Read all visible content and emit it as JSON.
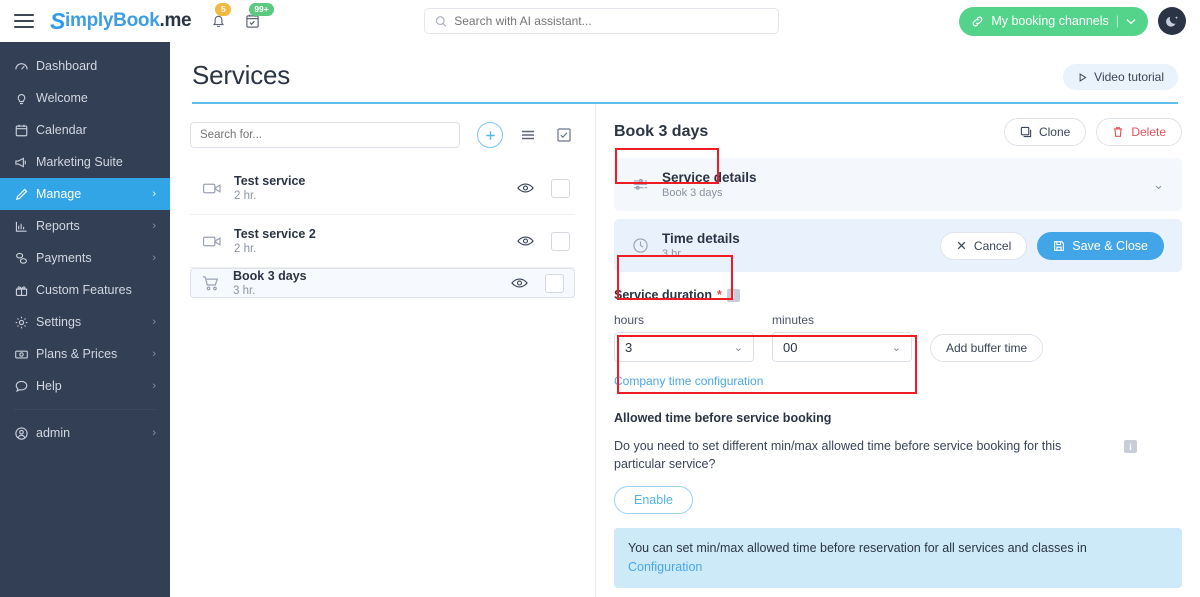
{
  "topbar": {
    "menu_icon": "hamburger-icon",
    "logo": {
      "s": "S",
      "simply": "implyBook",
      "dotme": ".me"
    },
    "bell_badge": "5",
    "calendar_badge": "99+",
    "search": {
      "placeholder": "Search with AI assistant...",
      "value": ""
    },
    "booking_channels_label": "My booking channels",
    "theme_toggle": "moon-icon"
  },
  "sidebar": {
    "items": [
      {
        "label": "Dashboard",
        "icon": "dashboard-icon",
        "chevron": false,
        "active": false
      },
      {
        "label": "Welcome",
        "icon": "bulb-icon",
        "chevron": false,
        "active": false
      },
      {
        "label": "Calendar",
        "icon": "calendar-icon",
        "chevron": false,
        "active": false
      },
      {
        "label": "Marketing Suite",
        "icon": "megaphone-icon",
        "chevron": false,
        "active": false
      },
      {
        "label": "Manage",
        "icon": "pencil-icon",
        "chevron": true,
        "active": true
      },
      {
        "label": "Reports",
        "icon": "chart-icon",
        "chevron": true,
        "active": false
      },
      {
        "label": "Payments",
        "icon": "coins-icon",
        "chevron": true,
        "active": false
      },
      {
        "label": "Custom Features",
        "icon": "gift-icon",
        "chevron": false,
        "active": false
      },
      {
        "label": "Settings",
        "icon": "gear-icon",
        "chevron": true,
        "active": false
      },
      {
        "label": "Plans & Prices",
        "icon": "money-icon",
        "chevron": true,
        "active": false
      },
      {
        "label": "Help",
        "icon": "chat-icon",
        "chevron": true,
        "active": false
      }
    ],
    "user": {
      "label": "admin",
      "icon": "user-icon",
      "chevron": true
    }
  },
  "page": {
    "title": "Services",
    "video_tutorial_label": "Video tutorial"
  },
  "list": {
    "search_placeholder": "Search for...",
    "search_value": "",
    "add_label": "+",
    "rows": [
      {
        "name": "Test service",
        "duration": "2 hr.",
        "icon": "video-camera-icon",
        "selected": false
      },
      {
        "name": "Test service 2",
        "duration": "2 hr.",
        "icon": "video-camera-icon",
        "selected": false
      },
      {
        "name": "Book 3 days",
        "duration": "3 hr.",
        "icon": "shopping-cart-icon",
        "selected": true
      }
    ]
  },
  "detail": {
    "title": "Book 3 days",
    "clone_label": "Clone",
    "delete_label": "Delete",
    "sections": {
      "service_details": {
        "title": "Service details",
        "subtitle": "Book 3 days"
      },
      "time_details": {
        "title": "Time details",
        "subtitle": "3 hr.",
        "cancel_label": "Cancel",
        "save_label": "Save & Close"
      }
    },
    "form": {
      "duration_label": "Service duration",
      "required_mark": "*",
      "hours_label": "hours",
      "hours_value": "3",
      "minutes_label": "minutes",
      "minutes_value": "00",
      "add_buffer_label": "Add buffer time",
      "company_time_link": "Company time configuration",
      "allowed_heading": "Allowed time before service booking",
      "allowed_question": "Do you need to set different min/max allowed time before service booking for this particular service?",
      "enable_label": "Enable",
      "notice_text": "You can set min/max allowed time before reservation for all services and classes in",
      "notice_link": "Configuration"
    }
  },
  "colors": {
    "accent_blue": "#42a5e8",
    "sidebar_bg": "#333f54",
    "green": "#54d38a",
    "danger_red": "#e8505b",
    "annotation_red": "#ee1c25",
    "badge_orange": "#f4b740",
    "badge_green": "#5bc97f"
  }
}
